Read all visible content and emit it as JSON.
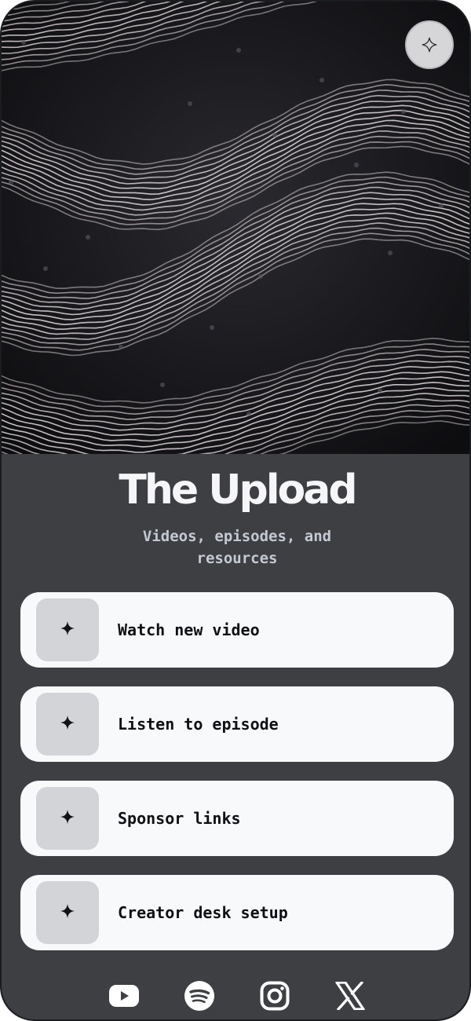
{
  "profile": {
    "title": "The Upload",
    "subtitle": "Videos, episodes, and resources"
  },
  "header": {
    "action_icon": "sparkle-icon"
  },
  "links": [
    {
      "label": "Watch new video",
      "icon": "sparkle-icon"
    },
    {
      "label": "Listen to episode",
      "icon": "sparkle-icon"
    },
    {
      "label": "Sponsor links",
      "icon": "sparkle-icon"
    },
    {
      "label": "Creator desk setup",
      "icon": "sparkle-icon"
    }
  ],
  "socials": [
    {
      "icon": "youtube-icon"
    },
    {
      "icon": "spotify-icon"
    },
    {
      "icon": "instagram-icon"
    },
    {
      "icon": "x-icon"
    }
  ],
  "colors": {
    "background": "#3e3f43",
    "card": "#f8f9fb",
    "thumb": "#d3d4d8",
    "title": "#f6f6f8",
    "subtitle": "#c4c9d3"
  }
}
